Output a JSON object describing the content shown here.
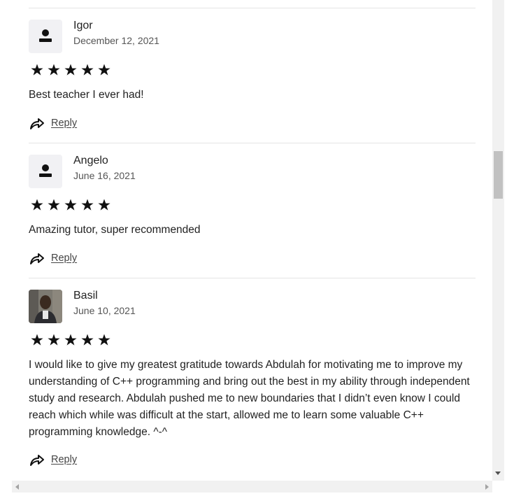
{
  "reviews": [
    {
      "name": "Igor",
      "date": "December 12, 2021",
      "rating": 5,
      "text": "Best teacher I ever had!",
      "reply_label": "Reply",
      "avatar": "default-user-icon"
    },
    {
      "name": "Angelo",
      "date": "June 16, 2021",
      "rating": 5,
      "text": "Amazing tutor, super recommended",
      "reply_label": "Reply",
      "avatar": "default-user-icon"
    },
    {
      "name": "Basil",
      "date": "June 10, 2021",
      "rating": 5,
      "text": "I would like to give my greatest gratitude towards Abdulah for motivating me to improve my understanding of C++ programming and bring out the best in my ability through independent study and research. Abdulah pushed me to new boundaries that I didn’t even know I could reach which while was difficult at the start, allowed me to learn some valuable C++ programming knowledge. ^-^",
      "reply_label": "Reply",
      "avatar": "user-photo"
    }
  ],
  "icons": {
    "star": "star-icon",
    "reply": "reply-arrow-icon"
  },
  "colors": {
    "star": "#111111",
    "divider": "#e4e4e4",
    "avatar_bg": "#f1f1f4"
  }
}
